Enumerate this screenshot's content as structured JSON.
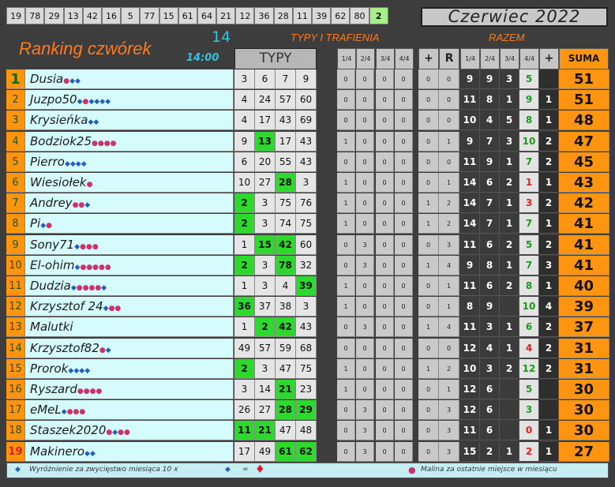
{
  "top_numbers": [
    "19",
    "78",
    "29",
    "13",
    "42",
    "16",
    "5",
    "77",
    "15",
    "61",
    "64",
    "21",
    "12",
    "36",
    "28",
    "11",
    "39",
    "62",
    "80",
    "2"
  ],
  "top_numbers_highlight": "2",
  "month_label": "Czerwiec 2022",
  "title": "Ranking czwórek",
  "round_number": "14",
  "time": "14:00",
  "section_typy": "TYPY I TRAFIENIA",
  "section_razem": "RAZEM",
  "typy_header": "TYPY",
  "small_headers": [
    "1/4",
    "2/4",
    "3/4",
    "4/4",
    "+",
    "R"
  ],
  "razem_headers": [
    "1/4",
    "2/4",
    "3/4",
    "4/4",
    "+"
  ],
  "suma_header": "SUMA",
  "rows": [
    {
      "rank": "1",
      "name": "Dusia",
      "badges": "r d d",
      "typy": [
        "3",
        "6",
        "7",
        "9"
      ],
      "hits": [
        false,
        false,
        false,
        false
      ],
      "sm": [
        "0",
        "0",
        "0",
        "0",
        "0",
        "0"
      ],
      "razem": [
        "9",
        "9",
        "3",
        "5",
        ""
      ],
      "c4red": false,
      "suma": "51"
    },
    {
      "rank": "2",
      "name": "Juzpo50",
      "badges": "d r d d d d",
      "typy": [
        "4",
        "24",
        "57",
        "60"
      ],
      "hits": [
        false,
        false,
        false,
        false
      ],
      "sm": [
        "0",
        "0",
        "0",
        "0",
        "0",
        "0"
      ],
      "razem": [
        "11",
        "8",
        "1",
        "9",
        "1"
      ],
      "c4red": false,
      "suma": "51"
    },
    {
      "rank": "3",
      "name": "Krysieńka",
      "badges": "d d",
      "typy": [
        "4",
        "17",
        "43",
        "69"
      ],
      "hits": [
        false,
        false,
        false,
        false
      ],
      "sm": [
        "0",
        "0",
        "0",
        "0",
        "0",
        "0"
      ],
      "razem": [
        "10",
        "4",
        "5",
        "8",
        "1"
      ],
      "c4red": false,
      "suma": "48"
    },
    {
      "rank": "4",
      "name": "Bodziok25",
      "badges": "r r r r",
      "typy": [
        "9",
        "13",
        "17",
        "43"
      ],
      "hits": [
        false,
        true,
        false,
        false
      ],
      "sm": [
        "1",
        "0",
        "0",
        "0",
        "0",
        "1"
      ],
      "razem": [
        "9",
        "7",
        "3",
        "10",
        "2"
      ],
      "c4red": false,
      "suma": "47"
    },
    {
      "rank": "5",
      "name": "Pierro",
      "badges": "d d d d",
      "typy": [
        "6",
        "20",
        "55",
        "43"
      ],
      "hits": [
        false,
        false,
        false,
        false
      ],
      "sm": [
        "0",
        "0",
        "0",
        "0",
        "0",
        "0"
      ],
      "razem": [
        "11",
        "9",
        "1",
        "7",
        "2"
      ],
      "c4red": false,
      "suma": "45"
    },
    {
      "rank": "6",
      "name": "Wiesiołek",
      "badges": "r",
      "typy": [
        "10",
        "27",
        "28",
        "3"
      ],
      "hits": [
        false,
        false,
        true,
        false
      ],
      "sm": [
        "1",
        "0",
        "0",
        "0",
        "0",
        "1"
      ],
      "razem": [
        "14",
        "6",
        "2",
        "1",
        "1"
      ],
      "c4red": true,
      "suma": "43"
    },
    {
      "rank": "7",
      "name": "Andrey",
      "badges": "r r d",
      "typy": [
        "2",
        "3",
        "75",
        "76"
      ],
      "hits": [
        true,
        false,
        false,
        false
      ],
      "sm": [
        "1",
        "0",
        "0",
        "0",
        "1",
        "2"
      ],
      "razem": [
        "14",
        "7",
        "1",
        "3",
        "2"
      ],
      "c4red": true,
      "suma": "42"
    },
    {
      "rank": "8",
      "name": "Pi",
      "badges": "d r",
      "typy": [
        "2",
        "3",
        "74",
        "75"
      ],
      "hits": [
        true,
        false,
        false,
        false
      ],
      "sm": [
        "1",
        "0",
        "0",
        "0",
        "1",
        "2"
      ],
      "razem": [
        "14",
        "7",
        "1",
        "7",
        "1"
      ],
      "c4red": false,
      "suma": "41"
    },
    {
      "rank": "9",
      "name": "Sony71",
      "badges": "d r r r",
      "typy": [
        "1",
        "15",
        "42",
        "60"
      ],
      "hits": [
        false,
        true,
        true,
        false
      ],
      "sm": [
        "0",
        "3",
        "0",
        "0",
        "0",
        "3"
      ],
      "razem": [
        "11",
        "6",
        "2",
        "5",
        "2"
      ],
      "c4red": false,
      "suma": "41"
    },
    {
      "rank": "10",
      "name": "El-ohim",
      "badges": "d r r r r r",
      "typy": [
        "2",
        "3",
        "78",
        "32"
      ],
      "hits": [
        true,
        false,
        true,
        false
      ],
      "sm": [
        "0",
        "3",
        "0",
        "0",
        "1",
        "4"
      ],
      "razem": [
        "9",
        "8",
        "1",
        "7",
        "3"
      ],
      "c4red": false,
      "suma": "41"
    },
    {
      "rank": "11",
      "name": "Dudzia",
      "badges": "d r r r r d",
      "typy": [
        "1",
        "3",
        "4",
        "39"
      ],
      "hits": [
        false,
        false,
        false,
        true
      ],
      "sm": [
        "1",
        "0",
        "0",
        "0",
        "0",
        "1"
      ],
      "razem": [
        "11",
        "6",
        "2",
        "8",
        "1"
      ],
      "c4red": false,
      "suma": "40"
    },
    {
      "rank": "12",
      "name": "Krzysztof 24",
      "badges": "d r r",
      "typy": [
        "36",
        "37",
        "38",
        "3"
      ],
      "hits": [
        true,
        false,
        false,
        false
      ],
      "sm": [
        "1",
        "0",
        "0",
        "0",
        "0",
        "1"
      ],
      "razem": [
        "8",
        "9",
        "",
        "10",
        "4"
      ],
      "c4red": false,
      "suma": "39"
    },
    {
      "rank": "13",
      "name": "Malutki",
      "badges": "",
      "typy": [
        "1",
        "2",
        "42",
        "43"
      ],
      "hits": [
        false,
        true,
        true,
        false
      ],
      "sm": [
        "0",
        "3",
        "0",
        "0",
        "1",
        "4"
      ],
      "razem": [
        "11",
        "3",
        "1",
        "6",
        "2"
      ],
      "c4red": false,
      "suma": "37"
    },
    {
      "rank": "14",
      "name": "Krzysztof82",
      "badges": "r d",
      "typy": [
        "49",
        "57",
        "59",
        "68"
      ],
      "hits": [
        false,
        false,
        false,
        false
      ],
      "sm": [
        "0",
        "0",
        "0",
        "0",
        "0",
        "0"
      ],
      "razem": [
        "12",
        "4",
        "1",
        "4",
        "2"
      ],
      "c4red": true,
      "suma": "31"
    },
    {
      "rank": "15",
      "name": "Prorok",
      "badges": "d d d d",
      "typy": [
        "2",
        "3",
        "47",
        "75"
      ],
      "hits": [
        true,
        false,
        false,
        false
      ],
      "sm": [
        "1",
        "0",
        "0",
        "0",
        "1",
        "2"
      ],
      "razem": [
        "10",
        "3",
        "2",
        "12",
        "2"
      ],
      "c4red": false,
      "suma": "31"
    },
    {
      "rank": "16",
      "name": "Ryszard",
      "badges": "r r r r",
      "typy": [
        "3",
        "14",
        "21",
        "23"
      ],
      "hits": [
        false,
        false,
        true,
        false
      ],
      "sm": [
        "1",
        "0",
        "0",
        "0",
        "0",
        "1"
      ],
      "razem": [
        "12",
        "6",
        "",
        "5",
        ""
      ],
      "c4red": false,
      "suma": "30"
    },
    {
      "rank": "17",
      "name": "eMeL",
      "badges": "d r r r",
      "typy": [
        "26",
        "27",
        "28",
        "29"
      ],
      "hits": [
        false,
        false,
        true,
        true
      ],
      "sm": [
        "0",
        "3",
        "0",
        "0",
        "0",
        "3"
      ],
      "razem": [
        "12",
        "6",
        "",
        "3",
        ""
      ],
      "c4red": false,
      "suma": "30"
    },
    {
      "rank": "18",
      "name": "Staszek2020",
      "badges": "r d r r",
      "typy": [
        "11",
        "21",
        "47",
        "48"
      ],
      "hits": [
        true,
        true,
        false,
        false
      ],
      "sm": [
        "0",
        "3",
        "0",
        "0",
        "0",
        "3"
      ],
      "razem": [
        "11",
        "6",
        "",
        "0",
        "1"
      ],
      "c4red": true,
      "suma": "30"
    },
    {
      "rank": "19",
      "name": "Makinero",
      "badges": "d d",
      "typy": [
        "17",
        "49",
        "61",
        "62"
      ],
      "hits": [
        false,
        false,
        true,
        true
      ],
      "sm": [
        "0",
        "3",
        "0",
        "0",
        "0",
        "3"
      ],
      "razem": [
        "15",
        "2",
        "1",
        "2",
        "1"
      ],
      "c4red": true,
      "suma": "27"
    }
  ],
  "footer_left": "Wyróżnienie za zwycięstwo miesiąca  10 x",
  "footer_eq": "=",
  "footer_right": "Malina za ostatnie miejsce w miesiącu",
  "colors": {
    "accent_orange": "#ff9410",
    "hit_green": "#2cd92c",
    "cyan_text": "#31c4e0",
    "name_bg": "#d6fbfd"
  }
}
